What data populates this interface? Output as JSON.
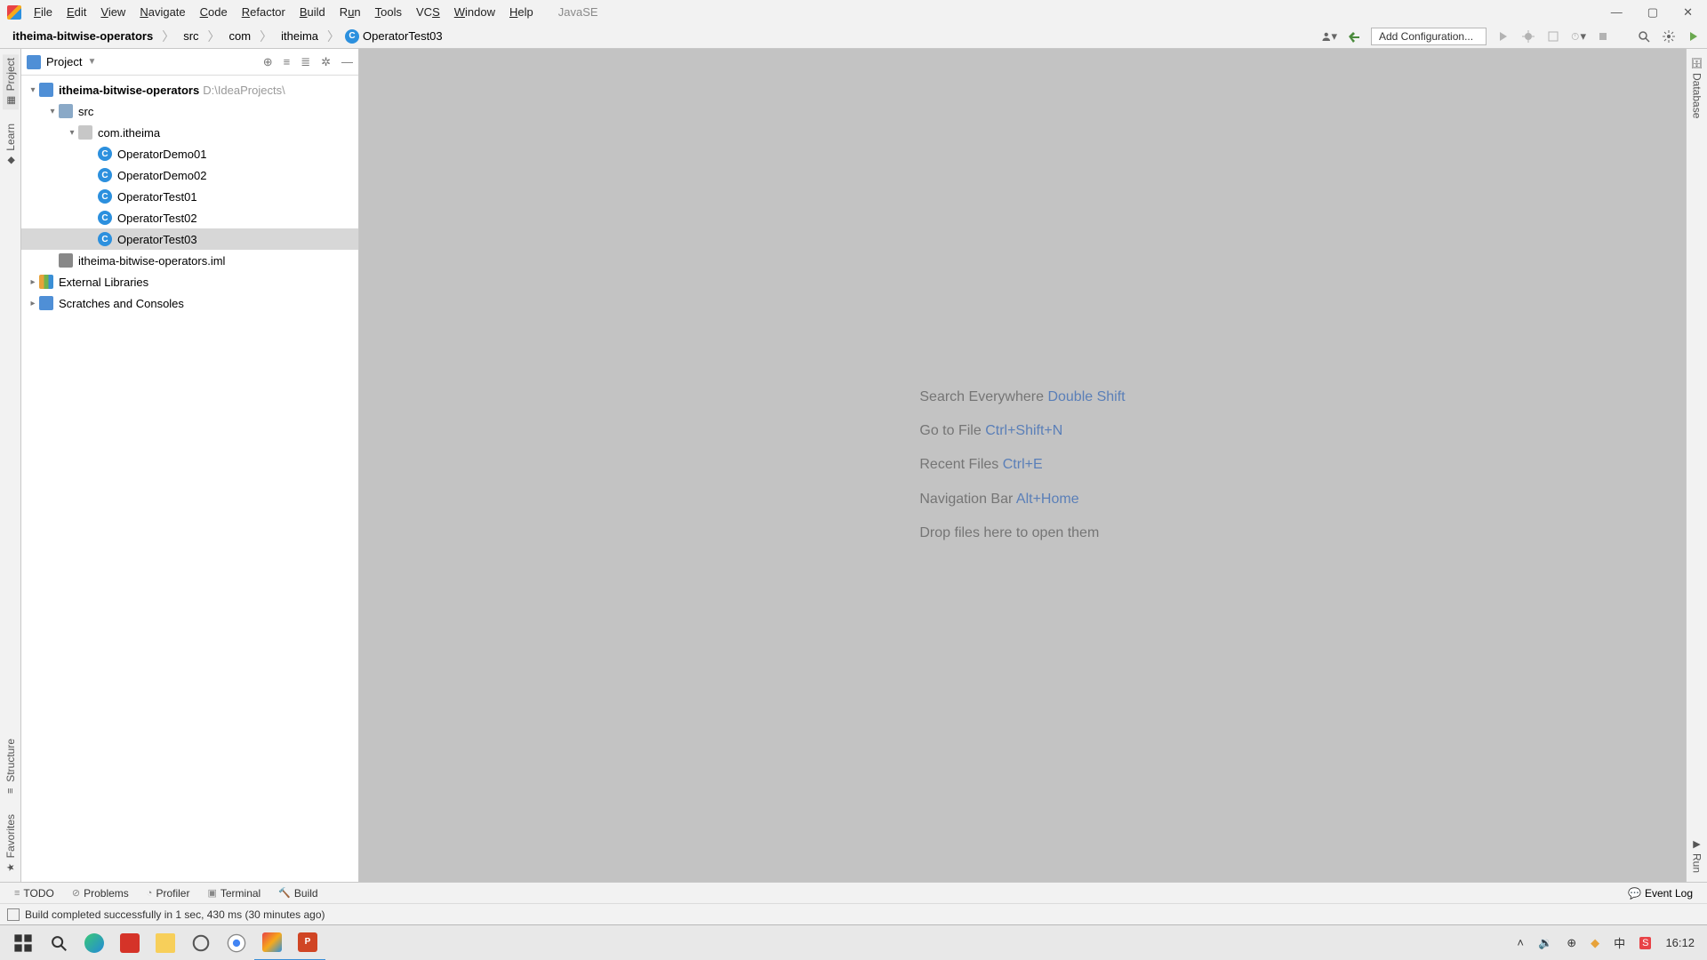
{
  "menubar": {
    "items": [
      "File",
      "Edit",
      "View",
      "Navigate",
      "Code",
      "Refactor",
      "Build",
      "Run",
      "Tools",
      "VCS",
      "Window",
      "Help"
    ],
    "workspace": "JavaSE"
  },
  "windowControls": {
    "minimize": "—",
    "maximize": "▢",
    "close": "✕"
  },
  "breadcrumbs": {
    "items": [
      {
        "text": "itheima-bitwise-operators",
        "bold": true
      },
      {
        "text": "src"
      },
      {
        "text": "com"
      },
      {
        "text": "itheima"
      },
      {
        "text": "OperatorTest03",
        "icon": "class"
      }
    ]
  },
  "toolbarRight": {
    "configLabel": "Add Configuration..."
  },
  "projectPanel": {
    "title": "Project"
  },
  "tree": {
    "root": {
      "name": "itheima-bitwise-operators",
      "path": "D:\\IdeaProjects\\"
    },
    "src": "src",
    "pkg": "com.itheima",
    "files": [
      "OperatorDemo01",
      "OperatorDemo02",
      "OperatorTest01",
      "OperatorTest02",
      "OperatorTest03"
    ],
    "selectedIndex": 4,
    "iml": "itheima-bitwise-operators.iml",
    "libraries": "External Libraries",
    "scratches": "Scratches and Consoles"
  },
  "leftStrip": {
    "tabs": [
      "Project",
      "Learn"
    ],
    "lowerTabs": [
      "Structure",
      "Favorites"
    ]
  },
  "rightStrip": {
    "topTab": "Database",
    "bottomTab": "Run"
  },
  "editorHints": {
    "rows": [
      {
        "label": "Search Everywhere ",
        "shortcut": "Double Shift"
      },
      {
        "label": "Go to File ",
        "shortcut": "Ctrl+Shift+N"
      },
      {
        "label": "Recent Files ",
        "shortcut": "Ctrl+E"
      },
      {
        "label": "Navigation Bar ",
        "shortcut": "Alt+Home"
      },
      {
        "label": "Drop files here to open them",
        "shortcut": ""
      }
    ]
  },
  "bottomTabs": {
    "items": [
      "TODO",
      "Problems",
      "Profiler",
      "Terminal",
      "Build"
    ],
    "eventLog": "Event Log"
  },
  "statusbar": {
    "message": "Build completed successfully in 1 sec, 430 ms (30 minutes ago)"
  },
  "taskbar": {
    "clock": "16:12"
  }
}
